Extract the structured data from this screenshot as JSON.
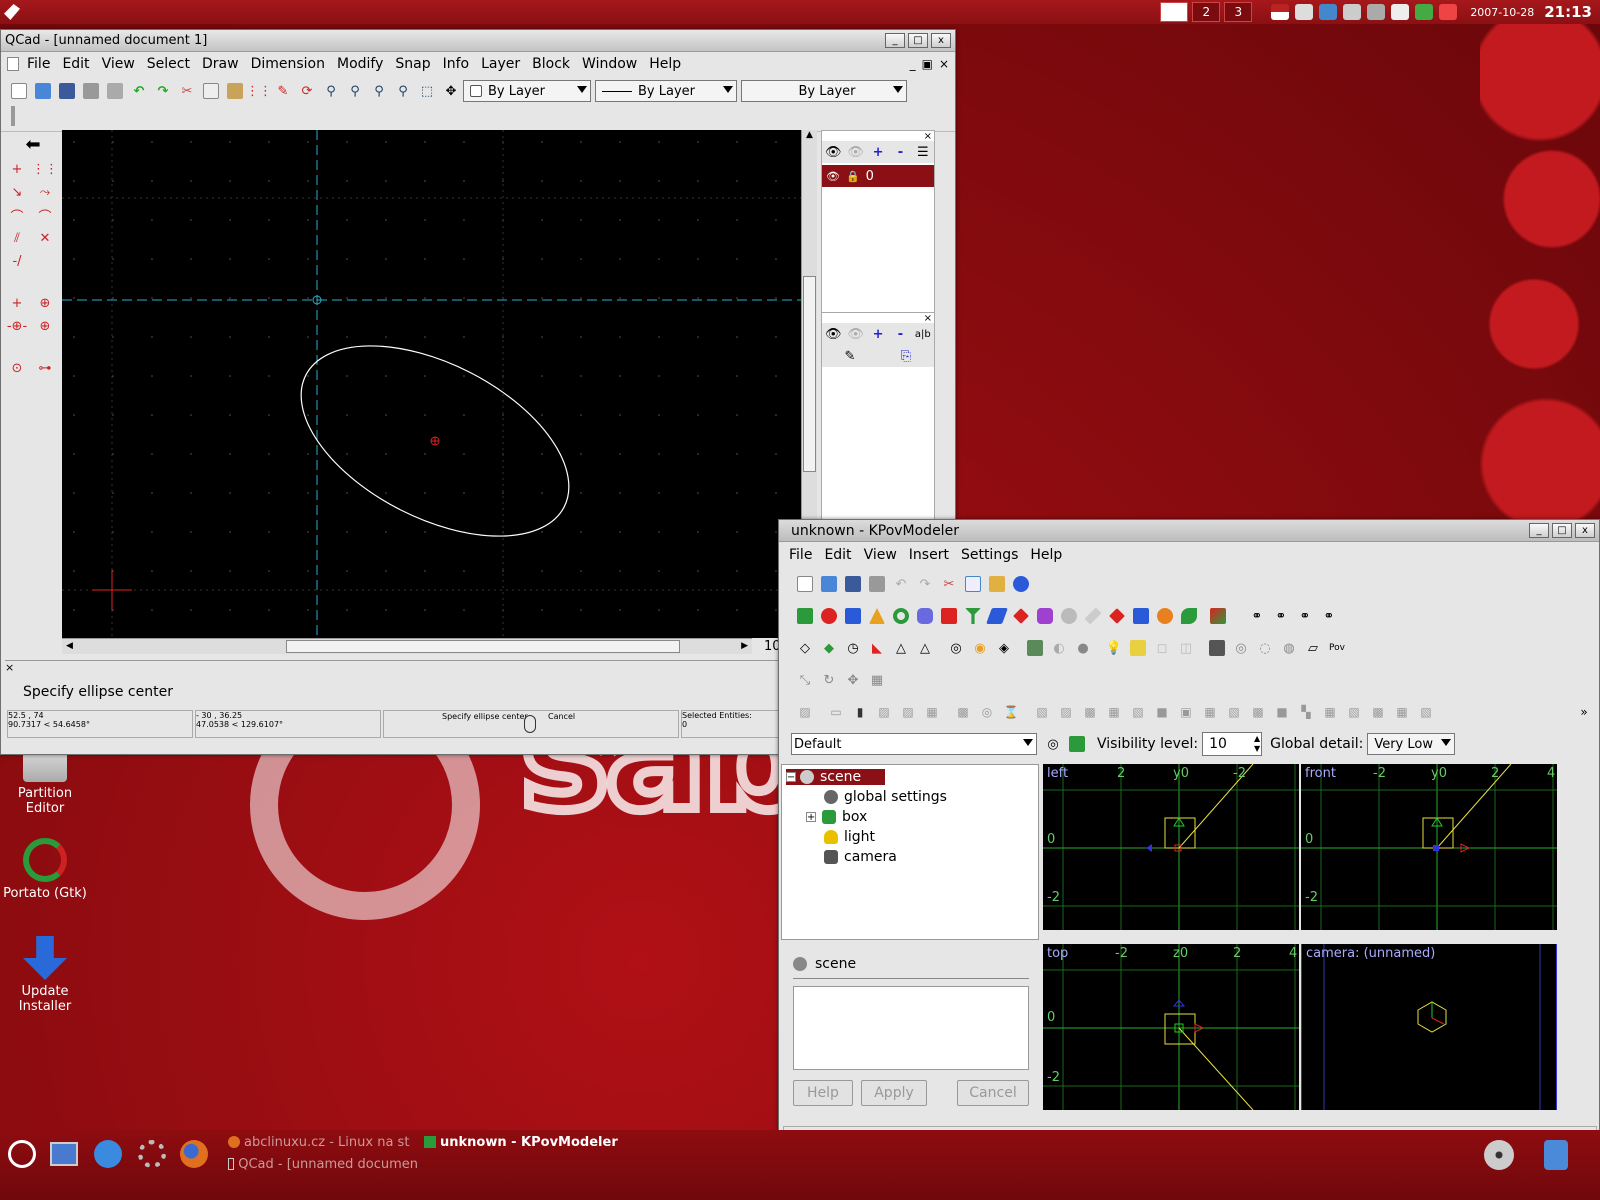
{
  "top_panel": {
    "workspaces": [
      "",
      "2",
      "3"
    ],
    "date": "2007-10-28",
    "time": "21:13"
  },
  "qcad": {
    "title": "QCad - [unnamed document 1]",
    "menu": [
      "File",
      "Edit",
      "View",
      "Select",
      "Draw",
      "Dimension",
      "Modify",
      "Snap",
      "Info",
      "Layer",
      "Block",
      "Window",
      "Help"
    ],
    "combos": [
      "By Layer",
      "By Layer",
      "By Layer"
    ],
    "layer_name": "0",
    "scroll_value": "10",
    "command_prompt": "Specify ellipse center",
    "status": {
      "abs_coord": "52.5 , 74",
      "abs_polar": "90.7317 < 54.6458°",
      "rel_coord": "- 30 , 36.25",
      "rel_polar": "47.0538 < 129.6107°",
      "mouse_left": "Specify ellipse center",
      "mouse_right": "Cancel",
      "selected_label": "Selected Entities:",
      "selected_count": "0"
    }
  },
  "kpov": {
    "title": "unknown - KPovModeler",
    "menu": [
      "File",
      "Edit",
      "View",
      "Insert",
      "Settings",
      "Help"
    ],
    "mode_combo": "Default",
    "visibility_label": "Visibility level:",
    "visibility_value": "10",
    "detail_label": "Global detail:",
    "detail_value": "Very Low",
    "tree": [
      "scene",
      "global settings",
      "box",
      "light",
      "camera"
    ],
    "props_title": "scene",
    "buttons": {
      "help": "Help",
      "apply": "Apply",
      "cancel": "Cancel"
    },
    "views": {
      "left": {
        "label": "left",
        "ticks_x": [
          "2",
          "y0",
          "-2"
        ],
        "ticks_y": [
          "0",
          "-2"
        ]
      },
      "front": {
        "label": "front",
        "ticks_x": [
          "-2",
          "y0",
          "2",
          "4"
        ],
        "ticks_y": [
          "0",
          "-2"
        ]
      },
      "top": {
        "label": "top",
        "ticks_x": [
          "-2",
          "z0",
          "2",
          "4"
        ],
        "ticks_y": [
          "0",
          "-2"
        ]
      },
      "camera": {
        "label": "camera: (unnamed)"
      }
    }
  },
  "desktop_icons": [
    {
      "label": "Partition Editor",
      "color": "#d8d8d8"
    },
    {
      "label": "Portato (Gtk)",
      "color": "#2a9a3a"
    },
    {
      "label": "Update Installer",
      "color": "#2a6ad8"
    }
  ],
  "taskbar": {
    "tasks": [
      "abclinuxu.cz - Linux na st",
      "unknown - KPovModeler",
      "QCad - [unnamed documen"
    ]
  },
  "background_logo_text": "sab"
}
